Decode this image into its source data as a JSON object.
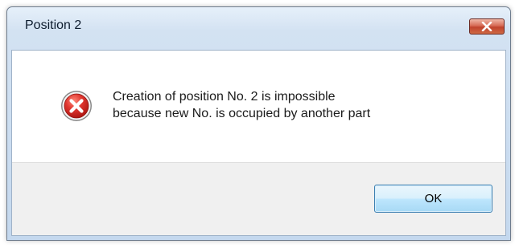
{
  "window": {
    "title": "Position 2",
    "close_icon": "close-icon"
  },
  "message": {
    "icon": "error-icon",
    "line1": "Creation of position No. 2 is impossible",
    "line2": "because new No. is occupied by another part"
  },
  "buttons": {
    "ok_label": "OK"
  },
  "colors": {
    "close_button": "#c7442e",
    "error_icon": "#d22a25",
    "ok_border": "#3c7fb1"
  }
}
